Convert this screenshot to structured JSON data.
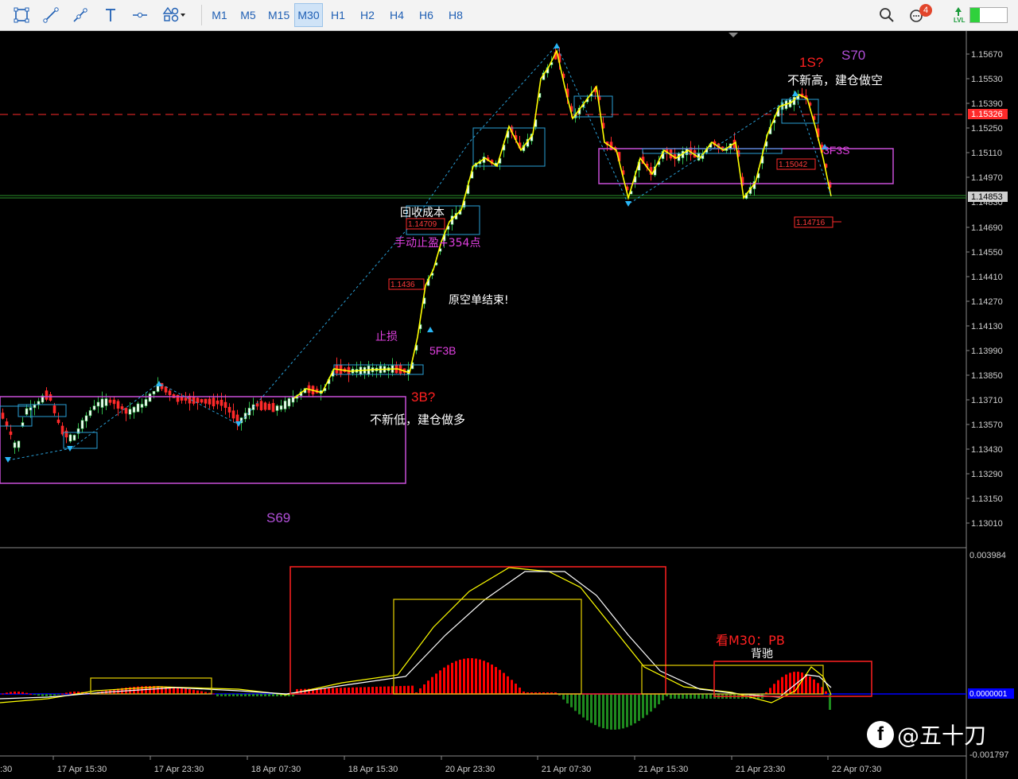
{
  "toolbar": {
    "draw_tools": [
      "crosshair-box-icon",
      "line-icon",
      "trendline-icon",
      "text-icon",
      "hline-icon",
      "shapes-icon"
    ],
    "timeframes": [
      "M1",
      "M5",
      "M15",
      "M30",
      "H1",
      "H2",
      "H4",
      "H6",
      "H8"
    ],
    "active_timeframe": "M30",
    "notification_count": "4",
    "lvl_label": "LVL"
  },
  "colors": {
    "up": "#2fb84a",
    "down": "#ff2a2a",
    "zigzag": "#ffff00",
    "box_purple": "#c84fd8",
    "box_blue": "#2a9fd6",
    "osc_red": "#ff0000",
    "osc_green": "#1e8a1e",
    "zero_line": "#0000ff"
  },
  "price_axis": {
    "ticks": [
      "1.15670",
      "1.15530",
      "1.15390",
      "1.15250",
      "1.15110",
      "1.14970",
      "1.14690",
      "1.14550",
      "1.14410",
      "1.14270",
      "1.14130",
      "1.13990",
      "1.13850",
      "1.13710",
      "1.13570",
      "1.13430",
      "1.13290",
      "1.13150",
      "1.13010"
    ],
    "tags": [
      "1.15326",
      "1.14853"
    ],
    "partial_tick": "1.14830"
  },
  "osc_axis": {
    "top": "0.003984",
    "zero": "0.0000001",
    "bottom": "-0.001797"
  },
  "time_axis": [
    "17 Apr 15:30",
    "17 Apr 23:30",
    "18 Apr 07:30",
    "18 Apr 15:30",
    "20 Apr 23:30",
    "21 Apr 07:30",
    "21 Apr 15:30",
    "21 Apr 23:30",
    "22 Apr 07:30"
  ],
  "time_axis_partial": ":30",
  "price_labels": [
    "1.14709",
    "1.1436",
    "1.15042",
    "1.14716"
  ],
  "annotations": {
    "s69": "S69",
    "s70": "S70",
    "b3": "3B?",
    "s1": "1S?",
    "no_new_low": "不新低，建仓做多",
    "no_new_high": "不新高，建仓做空",
    "recover_cost": "回收成本",
    "manual_tp": "手动止盈+354点",
    "orig_short_end": "原空单结束!",
    "stop_loss": "止损",
    "f3b": "5F3B",
    "f3s": "3F3S",
    "m30_pb": "看M30：PB",
    "divergence": "背驰"
  },
  "watermark": "@五十刀"
}
